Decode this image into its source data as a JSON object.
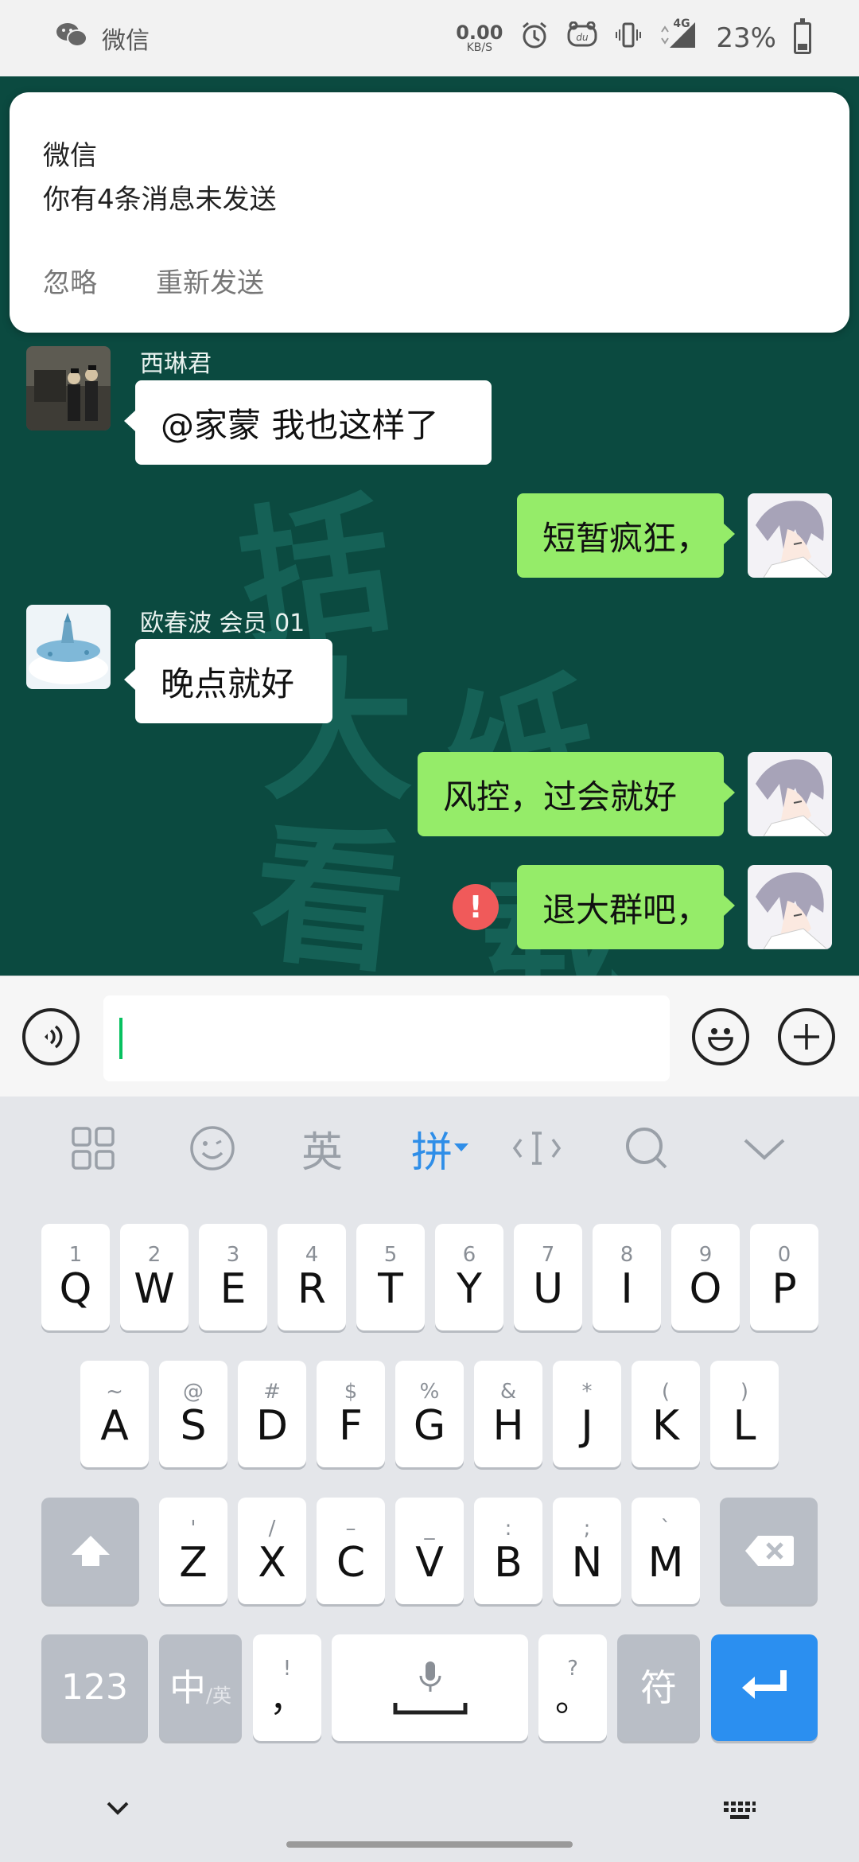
{
  "status_bar": {
    "app_label": "微信",
    "net_speed": "0.00",
    "net_unit": "KB/S",
    "network": "4G",
    "battery": "23%"
  },
  "notification": {
    "app": "微信",
    "message": "你有4条消息未发送",
    "ignore_label": "忽略",
    "resend_label": "重新发送"
  },
  "background_text": [
    "括",
    "大",
    "看",
    "纸",
    "载"
  ],
  "messages": [
    {
      "side": "in",
      "sender": "西琳君",
      "text": "@家蒙  我也这样了"
    },
    {
      "side": "out",
      "text": "短暂疯狂，"
    },
    {
      "side": "in",
      "sender": "欧春波  会员 01",
      "text": "晚点就好"
    },
    {
      "side": "out",
      "text": "风控，过会就好"
    },
    {
      "side": "out",
      "text": "退大群吧，",
      "error": "!"
    }
  ],
  "input": {
    "value": ""
  },
  "keyboard": {
    "toolbar": {
      "en": "英",
      "pinyin": "拼"
    },
    "row1": [
      {
        "hint": "1",
        "key": "Q"
      },
      {
        "hint": "2",
        "key": "W"
      },
      {
        "hint": "3",
        "key": "E"
      },
      {
        "hint": "4",
        "key": "R"
      },
      {
        "hint": "5",
        "key": "T"
      },
      {
        "hint": "6",
        "key": "Y"
      },
      {
        "hint": "7",
        "key": "U"
      },
      {
        "hint": "8",
        "key": "I"
      },
      {
        "hint": "9",
        "key": "O"
      },
      {
        "hint": "0",
        "key": "P"
      }
    ],
    "row2": [
      {
        "hint": "~",
        "key": "A"
      },
      {
        "hint": "@",
        "key": "S"
      },
      {
        "hint": "#",
        "key": "D"
      },
      {
        "hint": "$",
        "key": "F"
      },
      {
        "hint": "%",
        "key": "G"
      },
      {
        "hint": "&",
        "key": "H"
      },
      {
        "hint": "*",
        "key": "J"
      },
      {
        "hint": "(",
        "key": "K"
      },
      {
        "hint": ")",
        "key": "L"
      }
    ],
    "row3": [
      {
        "hint": "'",
        "key": "Z"
      },
      {
        "hint": "/",
        "key": "X"
      },
      {
        "hint": "–",
        "key": "C"
      },
      {
        "hint": "_",
        "key": "V"
      },
      {
        "hint": ":",
        "key": "B"
      },
      {
        "hint": ";",
        "key": "N"
      },
      {
        "hint": "`",
        "key": "M"
      }
    ],
    "num_key": "123",
    "lang_key_main": "中",
    "lang_key_sub": "/英",
    "comma_hint": "!",
    "comma_key": "，",
    "period_hint": "?",
    "period_key": "。",
    "symbol_key": "符"
  },
  "colors": {
    "chat_bg": "#0b4a40",
    "outgoing_bubble": "#95ec69",
    "incoming_bubble": "#ffffff",
    "error": "#f05a5a",
    "accent_blue": "#2b8ff0",
    "caret": "#07c160"
  }
}
